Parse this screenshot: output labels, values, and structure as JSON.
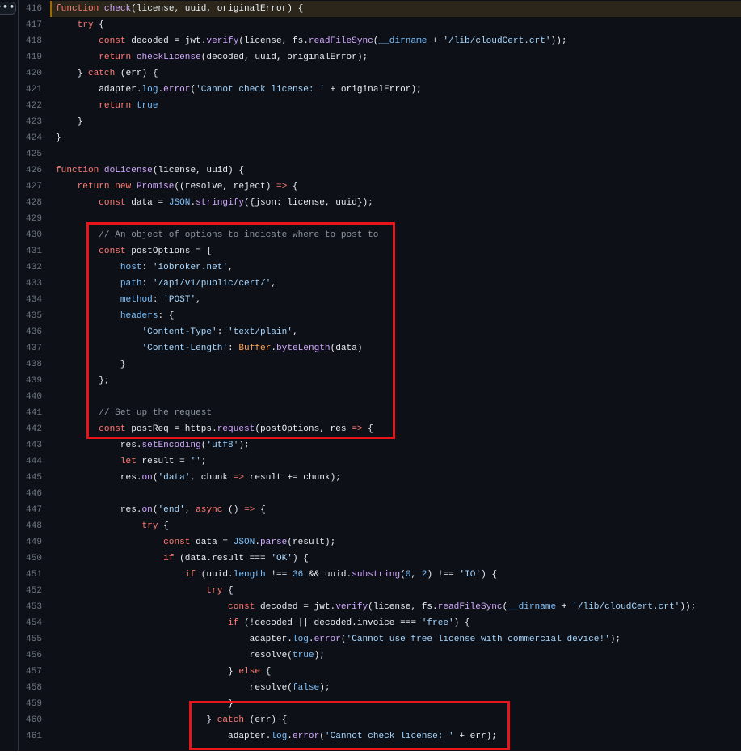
{
  "more_button": "•••",
  "lines": [
    {
      "n": "416",
      "highlight": true,
      "i": 0,
      "tokens": [
        [
          "k",
          "function "
        ],
        [
          "f",
          "check"
        ],
        [
          "t",
          "(license, uuid, originalError) {"
        ]
      ]
    },
    {
      "n": "417",
      "i": 4,
      "tokens": [
        [
          "k",
          "try"
        ],
        [
          "t",
          " {"
        ]
      ]
    },
    {
      "n": "418",
      "i": 8,
      "tokens": [
        [
          "k",
          "const "
        ],
        [
          "t",
          "decoded = jwt."
        ],
        [
          "f",
          "verify"
        ],
        [
          "t",
          "(license, fs."
        ],
        [
          "f",
          "readFileSync"
        ],
        [
          "t",
          "("
        ],
        [
          "c",
          "__dirname"
        ],
        [
          "t",
          " + "
        ],
        [
          "s",
          "'/lib/cloudCert.crt'"
        ],
        [
          "t",
          "));"
        ]
      ]
    },
    {
      "n": "419",
      "i": 8,
      "tokens": [
        [
          "k",
          "return "
        ],
        [
          "f",
          "checkLicense"
        ],
        [
          "t",
          "(decoded, uuid, originalError);"
        ]
      ]
    },
    {
      "n": "420",
      "i": 4,
      "tokens": [
        [
          "t",
          "} "
        ],
        [
          "k",
          "catch"
        ],
        [
          "t",
          " (err) {"
        ]
      ]
    },
    {
      "n": "421",
      "i": 8,
      "tokens": [
        [
          "t",
          "adapter."
        ],
        [
          "c",
          "log"
        ],
        [
          "t",
          "."
        ],
        [
          "f",
          "error"
        ],
        [
          "t",
          "("
        ],
        [
          "s",
          "'Cannot check license: '"
        ],
        [
          "t",
          " + originalError);"
        ]
      ]
    },
    {
      "n": "422",
      "i": 8,
      "tokens": [
        [
          "k",
          "return "
        ],
        [
          "c",
          "true"
        ]
      ]
    },
    {
      "n": "423",
      "i": 4,
      "tokens": [
        [
          "t",
          "}"
        ]
      ]
    },
    {
      "n": "424",
      "i": 0,
      "tokens": [
        [
          "t",
          "}"
        ]
      ]
    },
    {
      "n": "425",
      "i": 0,
      "tokens": []
    },
    {
      "n": "426",
      "i": 0,
      "tokens": [
        [
          "k",
          "function "
        ],
        [
          "f",
          "doLicense"
        ],
        [
          "t",
          "(license, uuid) {"
        ]
      ]
    },
    {
      "n": "427",
      "i": 4,
      "tokens": [
        [
          "k",
          "return new "
        ],
        [
          "f",
          "Promise"
        ],
        [
          "t",
          "((resolve, reject) "
        ],
        [
          "k",
          "=>"
        ],
        [
          "t",
          " {"
        ]
      ]
    },
    {
      "n": "428",
      "i": 8,
      "tokens": [
        [
          "k",
          "const "
        ],
        [
          "t",
          "data = "
        ],
        [
          "c",
          "JSON"
        ],
        [
          "t",
          "."
        ],
        [
          "f",
          "stringify"
        ],
        [
          "t",
          "({json: license, uuid});"
        ]
      ]
    },
    {
      "n": "429",
      "i": 0,
      "tokens": []
    },
    {
      "n": "430",
      "i": 8,
      "tokens": [
        [
          "m",
          "// An object of options to indicate where to post to"
        ]
      ]
    },
    {
      "n": "431",
      "i": 8,
      "tokens": [
        [
          "k",
          "const "
        ],
        [
          "t",
          "postOptions = {"
        ]
      ]
    },
    {
      "n": "432",
      "i": 12,
      "tokens": [
        [
          "c",
          "host"
        ],
        [
          "t",
          ": "
        ],
        [
          "s",
          "'iobroker.net'"
        ],
        [
          "t",
          ","
        ]
      ]
    },
    {
      "n": "433",
      "i": 12,
      "tokens": [
        [
          "c",
          "path"
        ],
        [
          "t",
          ": "
        ],
        [
          "s",
          "'/api/v1/public/cert/'"
        ],
        [
          "t",
          ","
        ]
      ]
    },
    {
      "n": "434",
      "i": 12,
      "tokens": [
        [
          "c",
          "method"
        ],
        [
          "t",
          ": "
        ],
        [
          "s",
          "'POST'"
        ],
        [
          "t",
          ","
        ]
      ]
    },
    {
      "n": "435",
      "i": 12,
      "tokens": [
        [
          "c",
          "headers"
        ],
        [
          "t",
          ": {"
        ]
      ]
    },
    {
      "n": "436",
      "i": 16,
      "tokens": [
        [
          "s",
          "'Content-Type'"
        ],
        [
          "t",
          ": "
        ],
        [
          "s",
          "'text/plain'"
        ],
        [
          "t",
          ","
        ]
      ]
    },
    {
      "n": "437",
      "i": 16,
      "tokens": [
        [
          "s",
          "'Content-Length'"
        ],
        [
          "t",
          ": "
        ],
        [
          "o",
          "Buffer"
        ],
        [
          "t",
          "."
        ],
        [
          "f",
          "byteLength"
        ],
        [
          "t",
          "(data)"
        ]
      ]
    },
    {
      "n": "438",
      "i": 12,
      "tokens": [
        [
          "t",
          "}"
        ]
      ]
    },
    {
      "n": "439",
      "i": 8,
      "tokens": [
        [
          "t",
          "};"
        ]
      ]
    },
    {
      "n": "440",
      "i": 0,
      "tokens": []
    },
    {
      "n": "441",
      "i": 8,
      "tokens": [
        [
          "m",
          "// Set up the request"
        ]
      ]
    },
    {
      "n": "442",
      "i": 8,
      "tokens": [
        [
          "k",
          "const "
        ],
        [
          "t",
          "postReq = https."
        ],
        [
          "f",
          "request"
        ],
        [
          "t",
          "(postOptions, res "
        ],
        [
          "k",
          "=>"
        ],
        [
          "t",
          " {"
        ]
      ]
    },
    {
      "n": "443",
      "i": 12,
      "tokens": [
        [
          "t",
          "res."
        ],
        [
          "f",
          "setEncoding"
        ],
        [
          "t",
          "("
        ],
        [
          "s",
          "'utf8'"
        ],
        [
          "t",
          ");"
        ]
      ]
    },
    {
      "n": "444",
      "i": 12,
      "tokens": [
        [
          "k",
          "let "
        ],
        [
          "t",
          "result = "
        ],
        [
          "s",
          "''"
        ],
        [
          "t",
          ";"
        ]
      ]
    },
    {
      "n": "445",
      "i": 12,
      "tokens": [
        [
          "t",
          "res."
        ],
        [
          "f",
          "on"
        ],
        [
          "t",
          "("
        ],
        [
          "s",
          "'data'"
        ],
        [
          "t",
          ", chunk "
        ],
        [
          "k",
          "=>"
        ],
        [
          "t",
          " result += chunk);"
        ]
      ]
    },
    {
      "n": "446",
      "i": 0,
      "tokens": []
    },
    {
      "n": "447",
      "i": 12,
      "tokens": [
        [
          "t",
          "res."
        ],
        [
          "f",
          "on"
        ],
        [
          "t",
          "("
        ],
        [
          "s",
          "'end'"
        ],
        [
          "t",
          ", "
        ],
        [
          "k",
          "async"
        ],
        [
          "t",
          " () "
        ],
        [
          "k",
          "=>"
        ],
        [
          "t",
          " {"
        ]
      ]
    },
    {
      "n": "448",
      "i": 16,
      "tokens": [
        [
          "k",
          "try"
        ],
        [
          "t",
          " {"
        ]
      ]
    },
    {
      "n": "449",
      "i": 20,
      "tokens": [
        [
          "k",
          "const "
        ],
        [
          "t",
          "data = "
        ],
        [
          "c",
          "JSON"
        ],
        [
          "t",
          "."
        ],
        [
          "f",
          "parse"
        ],
        [
          "t",
          "(result);"
        ]
      ]
    },
    {
      "n": "450",
      "i": 20,
      "tokens": [
        [
          "k",
          "if"
        ],
        [
          "t",
          " (data.result === "
        ],
        [
          "s",
          "'OK'"
        ],
        [
          "t",
          ") {"
        ]
      ]
    },
    {
      "n": "451",
      "i": 24,
      "tokens": [
        [
          "k",
          "if"
        ],
        [
          "t",
          " (uuid."
        ],
        [
          "c",
          "length"
        ],
        [
          "t",
          " !== "
        ],
        [
          "c",
          "36"
        ],
        [
          "t",
          " && uuid."
        ],
        [
          "f",
          "substring"
        ],
        [
          "t",
          "("
        ],
        [
          "c",
          "0"
        ],
        [
          "t",
          ", "
        ],
        [
          "c",
          "2"
        ],
        [
          "t",
          ") !== "
        ],
        [
          "s",
          "'IO'"
        ],
        [
          "t",
          ") {"
        ]
      ]
    },
    {
      "n": "452",
      "i": 28,
      "tokens": [
        [
          "k",
          "try"
        ],
        [
          "t",
          " {"
        ]
      ]
    },
    {
      "n": "453",
      "i": 32,
      "tokens": [
        [
          "k",
          "const "
        ],
        [
          "t",
          "decoded = jwt."
        ],
        [
          "f",
          "verify"
        ],
        [
          "t",
          "(license, fs."
        ],
        [
          "f",
          "readFileSync"
        ],
        [
          "t",
          "("
        ],
        [
          "c",
          "__dirname"
        ],
        [
          "t",
          " + "
        ],
        [
          "s",
          "'/lib/cloudCert.crt'"
        ],
        [
          "t",
          "));"
        ]
      ]
    },
    {
      "n": "454",
      "i": 32,
      "tokens": [
        [
          "k",
          "if"
        ],
        [
          "t",
          " (!decoded || decoded.invoice === "
        ],
        [
          "s",
          "'free'"
        ],
        [
          "t",
          ") {"
        ]
      ]
    },
    {
      "n": "455",
      "i": 36,
      "tokens": [
        [
          "t",
          "adapter."
        ],
        [
          "c",
          "log"
        ],
        [
          "t",
          "."
        ],
        [
          "f",
          "error"
        ],
        [
          "t",
          "("
        ],
        [
          "s",
          "'Cannot use free license with commercial device!'"
        ],
        [
          "t",
          ");"
        ]
      ]
    },
    {
      "n": "456",
      "i": 36,
      "tokens": [
        [
          "t",
          "resolve("
        ],
        [
          "c",
          "true"
        ],
        [
          "t",
          ");"
        ]
      ]
    },
    {
      "n": "457",
      "i": 32,
      "tokens": [
        [
          "t",
          "} "
        ],
        [
          "k",
          "else"
        ],
        [
          "t",
          " {"
        ]
      ]
    },
    {
      "n": "458",
      "i": 36,
      "tokens": [
        [
          "t",
          "resolve("
        ],
        [
          "c",
          "false"
        ],
        [
          "t",
          ");"
        ]
      ]
    },
    {
      "n": "459",
      "i": 32,
      "tokens": [
        [
          "t",
          "}"
        ]
      ]
    },
    {
      "n": "460",
      "i": 28,
      "tokens": [
        [
          "t",
          "} "
        ],
        [
          "k",
          "catch"
        ],
        [
          "t",
          " (err) {"
        ]
      ]
    },
    {
      "n": "461",
      "i": 32,
      "tokens": [
        [
          "t",
          "adapter."
        ],
        [
          "c",
          "log"
        ],
        [
          "t",
          "."
        ],
        [
          "f",
          "error"
        ],
        [
          "t",
          "("
        ],
        [
          "s",
          "'Cannot check license: '"
        ],
        [
          "t",
          " + err);"
        ]
      ]
    }
  ]
}
